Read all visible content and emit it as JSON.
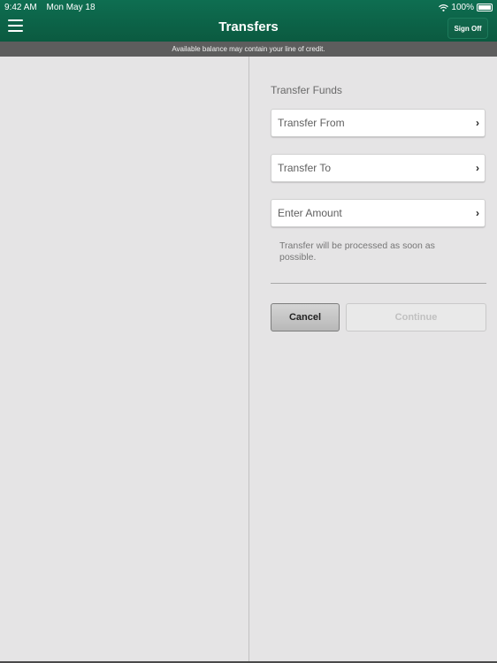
{
  "status_bar": {
    "time": "9:42 AM",
    "date": "Mon May 18",
    "battery": "100%"
  },
  "header": {
    "title": "Transfers",
    "sign_off": "Sign Off"
  },
  "notice": "Available balance may contain your line of credit.",
  "form": {
    "section_label": "Transfer Funds",
    "fields": [
      {
        "label": "Transfer From"
      },
      {
        "label": "Transfer To"
      },
      {
        "label": "Enter Amount"
      }
    ],
    "note": "Transfer will be processed as soon as possible.",
    "cancel_label": "Cancel",
    "continue_label": "Continue"
  },
  "icons": {
    "chevron": "›"
  }
}
